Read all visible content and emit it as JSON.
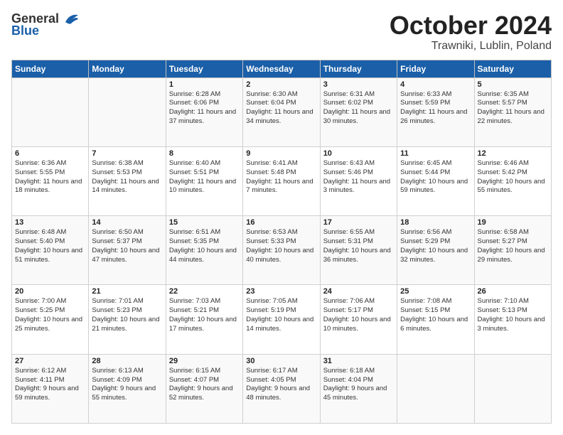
{
  "header": {
    "logo_general": "General",
    "logo_blue": "Blue",
    "month_title": "October 2024",
    "location": "Trawniki, Lublin, Poland"
  },
  "columns": [
    "Sunday",
    "Monday",
    "Tuesday",
    "Wednesday",
    "Thursday",
    "Friday",
    "Saturday"
  ],
  "weeks": [
    [
      {
        "day": "",
        "content": ""
      },
      {
        "day": "",
        "content": ""
      },
      {
        "day": "1",
        "content": "Sunrise: 6:28 AM\nSunset: 6:06 PM\nDaylight: 11 hours\nand 37 minutes."
      },
      {
        "day": "2",
        "content": "Sunrise: 6:30 AM\nSunset: 6:04 PM\nDaylight: 11 hours\nand 34 minutes."
      },
      {
        "day": "3",
        "content": "Sunrise: 6:31 AM\nSunset: 6:02 PM\nDaylight: 11 hours\nand 30 minutes."
      },
      {
        "day": "4",
        "content": "Sunrise: 6:33 AM\nSunset: 5:59 PM\nDaylight: 11 hours\nand 26 minutes."
      },
      {
        "day": "5",
        "content": "Sunrise: 6:35 AM\nSunset: 5:57 PM\nDaylight: 11 hours\nand 22 minutes."
      }
    ],
    [
      {
        "day": "6",
        "content": "Sunrise: 6:36 AM\nSunset: 5:55 PM\nDaylight: 11 hours\nand 18 minutes."
      },
      {
        "day": "7",
        "content": "Sunrise: 6:38 AM\nSunset: 5:53 PM\nDaylight: 11 hours\nand 14 minutes."
      },
      {
        "day": "8",
        "content": "Sunrise: 6:40 AM\nSunset: 5:51 PM\nDaylight: 11 hours\nand 10 minutes."
      },
      {
        "day": "9",
        "content": "Sunrise: 6:41 AM\nSunset: 5:48 PM\nDaylight: 11 hours\nand 7 minutes."
      },
      {
        "day": "10",
        "content": "Sunrise: 6:43 AM\nSunset: 5:46 PM\nDaylight: 11 hours\nand 3 minutes."
      },
      {
        "day": "11",
        "content": "Sunrise: 6:45 AM\nSunset: 5:44 PM\nDaylight: 10 hours\nand 59 minutes."
      },
      {
        "day": "12",
        "content": "Sunrise: 6:46 AM\nSunset: 5:42 PM\nDaylight: 10 hours\nand 55 minutes."
      }
    ],
    [
      {
        "day": "13",
        "content": "Sunrise: 6:48 AM\nSunset: 5:40 PM\nDaylight: 10 hours\nand 51 minutes."
      },
      {
        "day": "14",
        "content": "Sunrise: 6:50 AM\nSunset: 5:37 PM\nDaylight: 10 hours\nand 47 minutes."
      },
      {
        "day": "15",
        "content": "Sunrise: 6:51 AM\nSunset: 5:35 PM\nDaylight: 10 hours\nand 44 minutes."
      },
      {
        "day": "16",
        "content": "Sunrise: 6:53 AM\nSunset: 5:33 PM\nDaylight: 10 hours\nand 40 minutes."
      },
      {
        "day": "17",
        "content": "Sunrise: 6:55 AM\nSunset: 5:31 PM\nDaylight: 10 hours\nand 36 minutes."
      },
      {
        "day": "18",
        "content": "Sunrise: 6:56 AM\nSunset: 5:29 PM\nDaylight: 10 hours\nand 32 minutes."
      },
      {
        "day": "19",
        "content": "Sunrise: 6:58 AM\nSunset: 5:27 PM\nDaylight: 10 hours\nand 29 minutes."
      }
    ],
    [
      {
        "day": "20",
        "content": "Sunrise: 7:00 AM\nSunset: 5:25 PM\nDaylight: 10 hours\nand 25 minutes."
      },
      {
        "day": "21",
        "content": "Sunrise: 7:01 AM\nSunset: 5:23 PM\nDaylight: 10 hours\nand 21 minutes."
      },
      {
        "day": "22",
        "content": "Sunrise: 7:03 AM\nSunset: 5:21 PM\nDaylight: 10 hours\nand 17 minutes."
      },
      {
        "day": "23",
        "content": "Sunrise: 7:05 AM\nSunset: 5:19 PM\nDaylight: 10 hours\nand 14 minutes."
      },
      {
        "day": "24",
        "content": "Sunrise: 7:06 AM\nSunset: 5:17 PM\nDaylight: 10 hours\nand 10 minutes."
      },
      {
        "day": "25",
        "content": "Sunrise: 7:08 AM\nSunset: 5:15 PM\nDaylight: 10 hours\nand 6 minutes."
      },
      {
        "day": "26",
        "content": "Sunrise: 7:10 AM\nSunset: 5:13 PM\nDaylight: 10 hours\nand 3 minutes."
      }
    ],
    [
      {
        "day": "27",
        "content": "Sunrise: 6:12 AM\nSunset: 4:11 PM\nDaylight: 9 hours\nand 59 minutes."
      },
      {
        "day": "28",
        "content": "Sunrise: 6:13 AM\nSunset: 4:09 PM\nDaylight: 9 hours\nand 55 minutes."
      },
      {
        "day": "29",
        "content": "Sunrise: 6:15 AM\nSunset: 4:07 PM\nDaylight: 9 hours\nand 52 minutes."
      },
      {
        "day": "30",
        "content": "Sunrise: 6:17 AM\nSunset: 4:05 PM\nDaylight: 9 hours\nand 48 minutes."
      },
      {
        "day": "31",
        "content": "Sunrise: 6:18 AM\nSunset: 4:04 PM\nDaylight: 9 hours\nand 45 minutes."
      },
      {
        "day": "",
        "content": ""
      },
      {
        "day": "",
        "content": ""
      }
    ]
  ]
}
